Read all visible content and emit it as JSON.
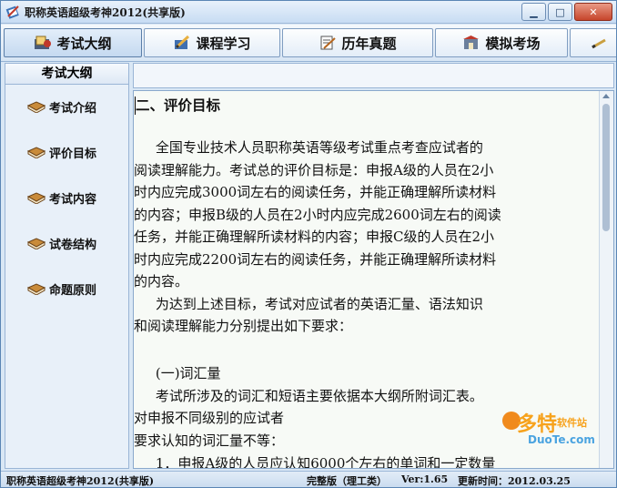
{
  "window": {
    "title": "职称英语超级考神2012(共享版)"
  },
  "toolbar": {
    "tabs": [
      {
        "label": "考试大纲",
        "icon": "syllabus-icon"
      },
      {
        "label": "课程学习",
        "icon": "pencil-book-icon"
      },
      {
        "label": "历年真题",
        "icon": "exam-paper-icon"
      },
      {
        "label": "模拟考场",
        "icon": "exam-room-icon"
      }
    ]
  },
  "sidebar": {
    "header": "考试大纲",
    "items": [
      {
        "label": "考试介绍"
      },
      {
        "label": "评价目标"
      },
      {
        "label": "考试内容"
      },
      {
        "label": "试卷结构"
      },
      {
        "label": "命题原则"
      }
    ]
  },
  "content": {
    "heading": "二、评价目标",
    "lines": [
      "     全国专业技术人员职称英语等级考试重点考查应试者的",
      "阅读理解能力。考试总的评价目标是：申报A级的人员在2小",
      "时内应完成3000词左右的阅读任务，并能正确理解所读材料",
      "的内容；申报B级的人员在2小时内应完成2600词左右的阅读",
      "任务，并能正确理解所读材料的内容；申报C级的人员在2小",
      "时内应完成2200词左右的阅读任务，并能正确理解所读材料",
      "的内容。",
      "     为达到上述目标，考试对应试者的英语汇量、语法知识",
      "和阅读理解能力分别提出如下要求：",
      "",
      "     (一)词汇量",
      "     考试所涉及的词汇和短语主要依据本大纲所附词汇表。",
      "对申报不同级别的应试者",
      "要求认知的词汇量不等：",
      "     1．申报A级的人员应认知6000个左右的单词和一定数量"
    ]
  },
  "watermark": {
    "brand": "多特",
    "sub": "软件站",
    "url": "DuoTe.com"
  },
  "status": {
    "app": "职称英语超级考神2012(共享版)",
    "edition": "完整版（理工类）",
    "version": "Ver:1.65",
    "updated": "更新时间：2012.03.25"
  }
}
